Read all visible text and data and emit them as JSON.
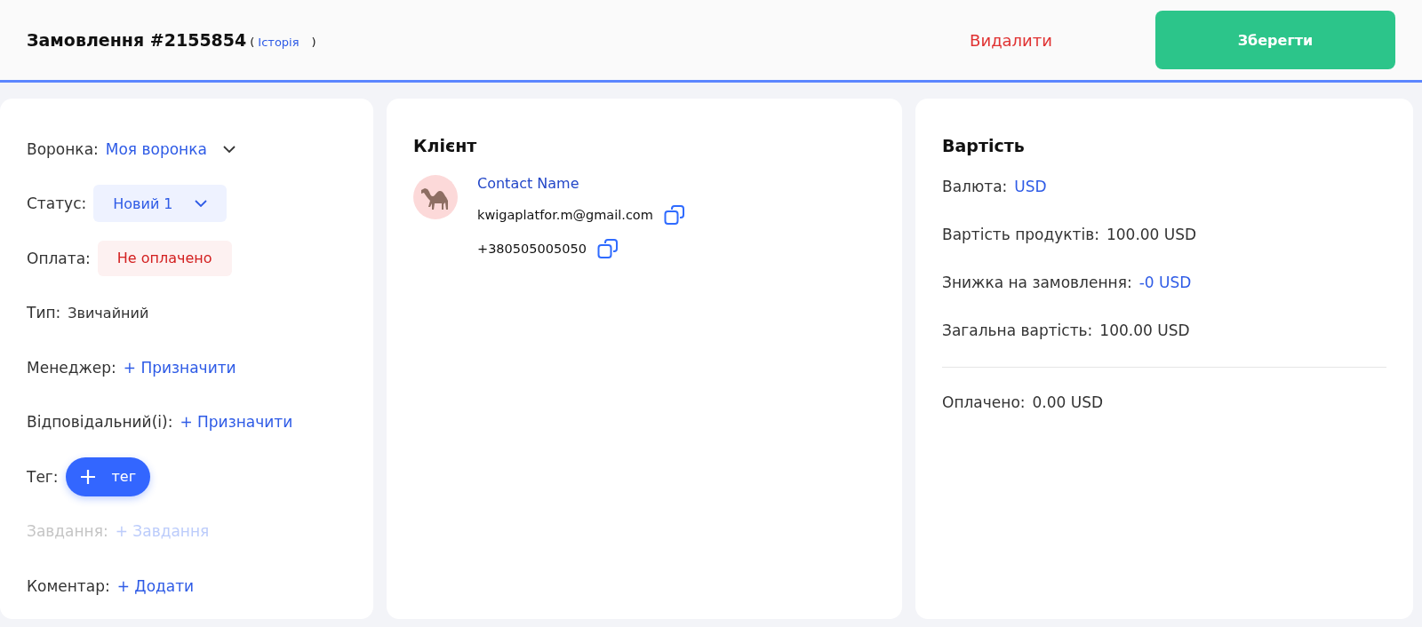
{
  "header": {
    "title": "Замовлення #2155854",
    "open_paren": "(",
    "history_link": "Історія",
    "close_paren": ")",
    "delete_button": "Видалити",
    "save_button": "Зберегти"
  },
  "order": {
    "rows": [
      {
        "kind": "dropdown",
        "label": "Воронка:",
        "value": "Моя воронка",
        "disabled": false
      },
      {
        "kind": "select",
        "label": "Статус:",
        "value": "Новий 1",
        "disabled": false
      },
      {
        "kind": "badge",
        "label": "Оплата:",
        "value": "Не оплачено",
        "disabled": false
      },
      {
        "kind": "text",
        "label": "Тип:",
        "value": "Звичайний",
        "disabled": false
      },
      {
        "kind": "link",
        "label": "Менеджер:",
        "value": "+ Призначити",
        "disabled": false
      },
      {
        "kind": "link",
        "label": "Відповідальний(і):",
        "value": "+ Призначити",
        "disabled": false
      },
      {
        "kind": "tag",
        "label": "Тег:",
        "value": "тег",
        "disabled": false
      },
      {
        "kind": "link",
        "label": "Завдання:",
        "value": "+ Завдання",
        "disabled": true
      },
      {
        "kind": "link",
        "label": "Коментар:",
        "value": "+ Додати",
        "disabled": false
      }
    ]
  },
  "client": {
    "title": "Клієнт",
    "name": "Contact Name",
    "email": "kwigaplatfor.m@gmail.com",
    "phone": "+380505005050"
  },
  "cost": {
    "title": "Вартість",
    "rows": [
      {
        "kind": "link",
        "label": "Валюта:",
        "value": "USD"
      },
      {
        "kind": "text",
        "label": "Вартість продуктів:",
        "value": "100.00 USD"
      },
      {
        "kind": "link",
        "label": "Знижка на замовлення:",
        "value": "-0 USD"
      },
      {
        "kind": "text",
        "label": "Загальна вартість:",
        "value": "100.00 USD"
      }
    ],
    "paid_rows": [
      {
        "kind": "text",
        "label": "Оплачено:",
        "value": "0.00 USD"
      }
    ]
  }
}
